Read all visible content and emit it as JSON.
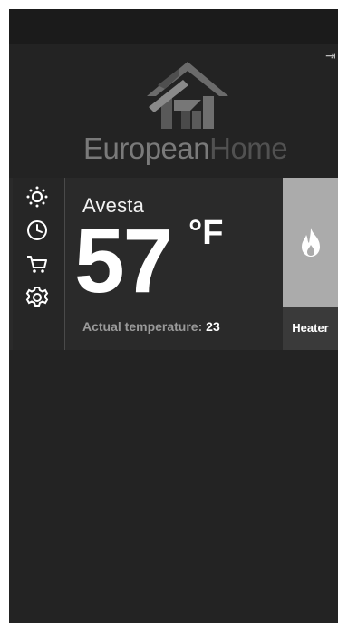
{
  "brand": {
    "name_part1": "European",
    "name_part2": "Home"
  },
  "thermostat": {
    "location": "Avesta",
    "set_temperature": "57",
    "unit": "°F",
    "actual_label": "Actual temperature:",
    "actual_value": "23"
  },
  "heater": {
    "label": "Heater",
    "icon": "flame-icon"
  },
  "menu": [
    {
      "name": "brightness",
      "icon": "sun-icon"
    },
    {
      "name": "schedule",
      "icon": "clock-icon"
    },
    {
      "name": "shop",
      "icon": "cart-icon"
    },
    {
      "name": "settings",
      "icon": "gear-icon"
    }
  ],
  "colors": {
    "background": "#232323",
    "card": "#2a2a2a",
    "heater_panel": "#ababab",
    "heater_label_bg": "#3a3a3a"
  }
}
